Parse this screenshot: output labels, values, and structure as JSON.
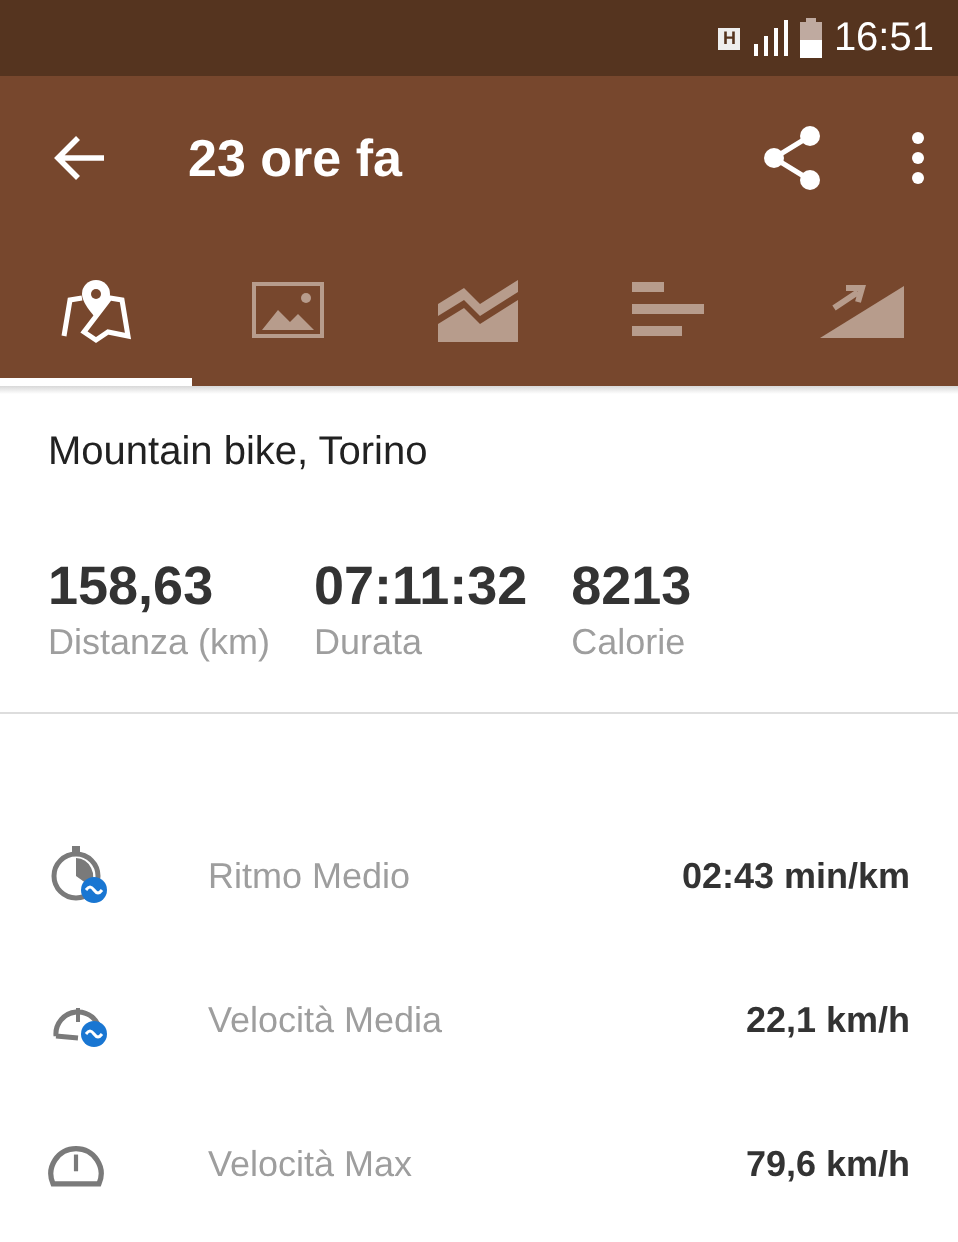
{
  "status_bar": {
    "time": "16:51",
    "network_badge": "H"
  },
  "toolbar": {
    "title": "23 ore fa"
  },
  "tabs": [
    {
      "kind": "map",
      "selected": true
    },
    {
      "kind": "photos",
      "selected": false
    },
    {
      "kind": "chart",
      "selected": false
    },
    {
      "kind": "bars",
      "selected": false
    },
    {
      "kind": "elevation",
      "selected": false
    }
  ],
  "activity": {
    "title": "Mountain bike, Torino"
  },
  "summary": [
    {
      "value": "158,63",
      "label": "Distanza (km)"
    },
    {
      "value": "07:11:32",
      "label": "Durata"
    },
    {
      "value": "8213",
      "label": "Calorie"
    }
  ],
  "metrics": [
    {
      "kind": "pace",
      "label": "Ritmo Medio",
      "value": "02:43 min/km"
    },
    {
      "kind": "avg-speed",
      "label": "Velocità Media",
      "value": "22,1 km/h"
    },
    {
      "kind": "max-speed",
      "label": "Velocità Max",
      "value": "79,6 km/h"
    }
  ]
}
